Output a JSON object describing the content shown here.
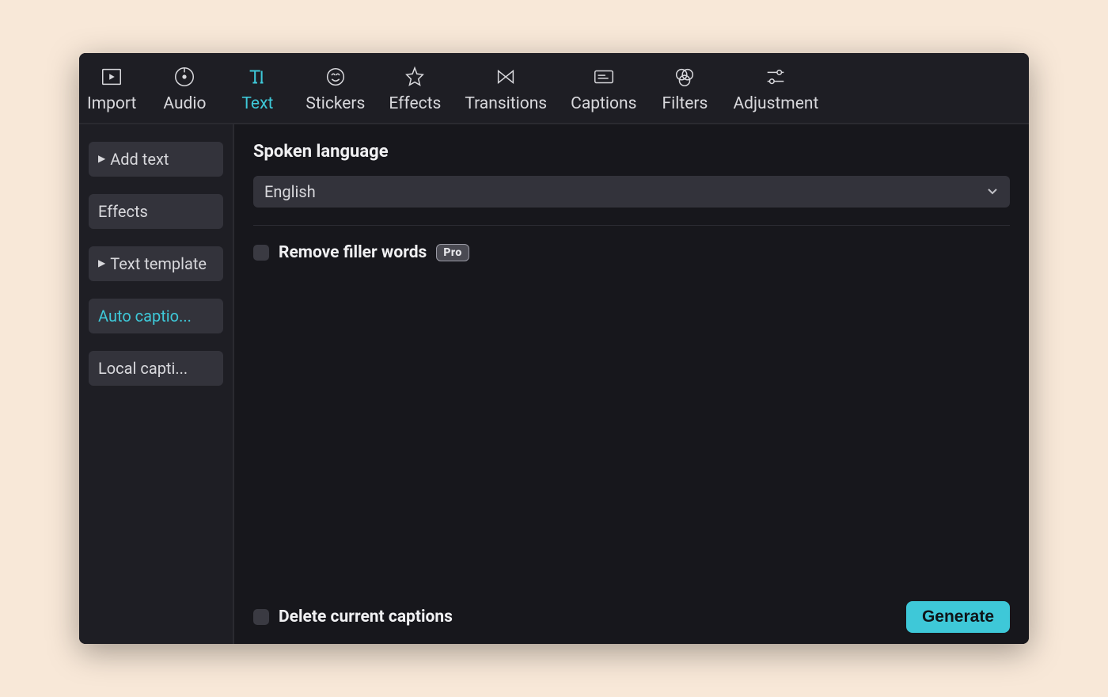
{
  "toolbar": {
    "items": [
      {
        "label": "Import",
        "icon": "import-icon",
        "active": false
      },
      {
        "label": "Audio",
        "icon": "audio-icon",
        "active": false
      },
      {
        "label": "Text",
        "icon": "text-icon",
        "active": true
      },
      {
        "label": "Stickers",
        "icon": "stickers-icon",
        "active": false
      },
      {
        "label": "Effects",
        "icon": "effects-icon",
        "active": false
      },
      {
        "label": "Transitions",
        "icon": "transitions-icon",
        "active": false
      },
      {
        "label": "Captions",
        "icon": "captions-icon",
        "active": false
      },
      {
        "label": "Filters",
        "icon": "filters-icon",
        "active": false
      },
      {
        "label": "Adjustment",
        "icon": "adjustment-icon",
        "active": false
      }
    ]
  },
  "sidebar": {
    "items": [
      {
        "label": "Add text",
        "has_caret": true,
        "active": false
      },
      {
        "label": "Effects",
        "has_caret": false,
        "active": false
      },
      {
        "label": "Text template",
        "has_caret": true,
        "active": false
      },
      {
        "label": "Auto captio...",
        "has_caret": false,
        "active": true
      },
      {
        "label": "Local capti...",
        "has_caret": false,
        "active": false
      }
    ]
  },
  "main": {
    "section_title": "Spoken language",
    "language_select": {
      "value": "English"
    },
    "remove_filler": {
      "label": "Remove filler words",
      "badge": "Pro",
      "checked": false
    },
    "delete_captions": {
      "label": "Delete current captions",
      "checked": false
    },
    "generate_button": "Generate"
  }
}
